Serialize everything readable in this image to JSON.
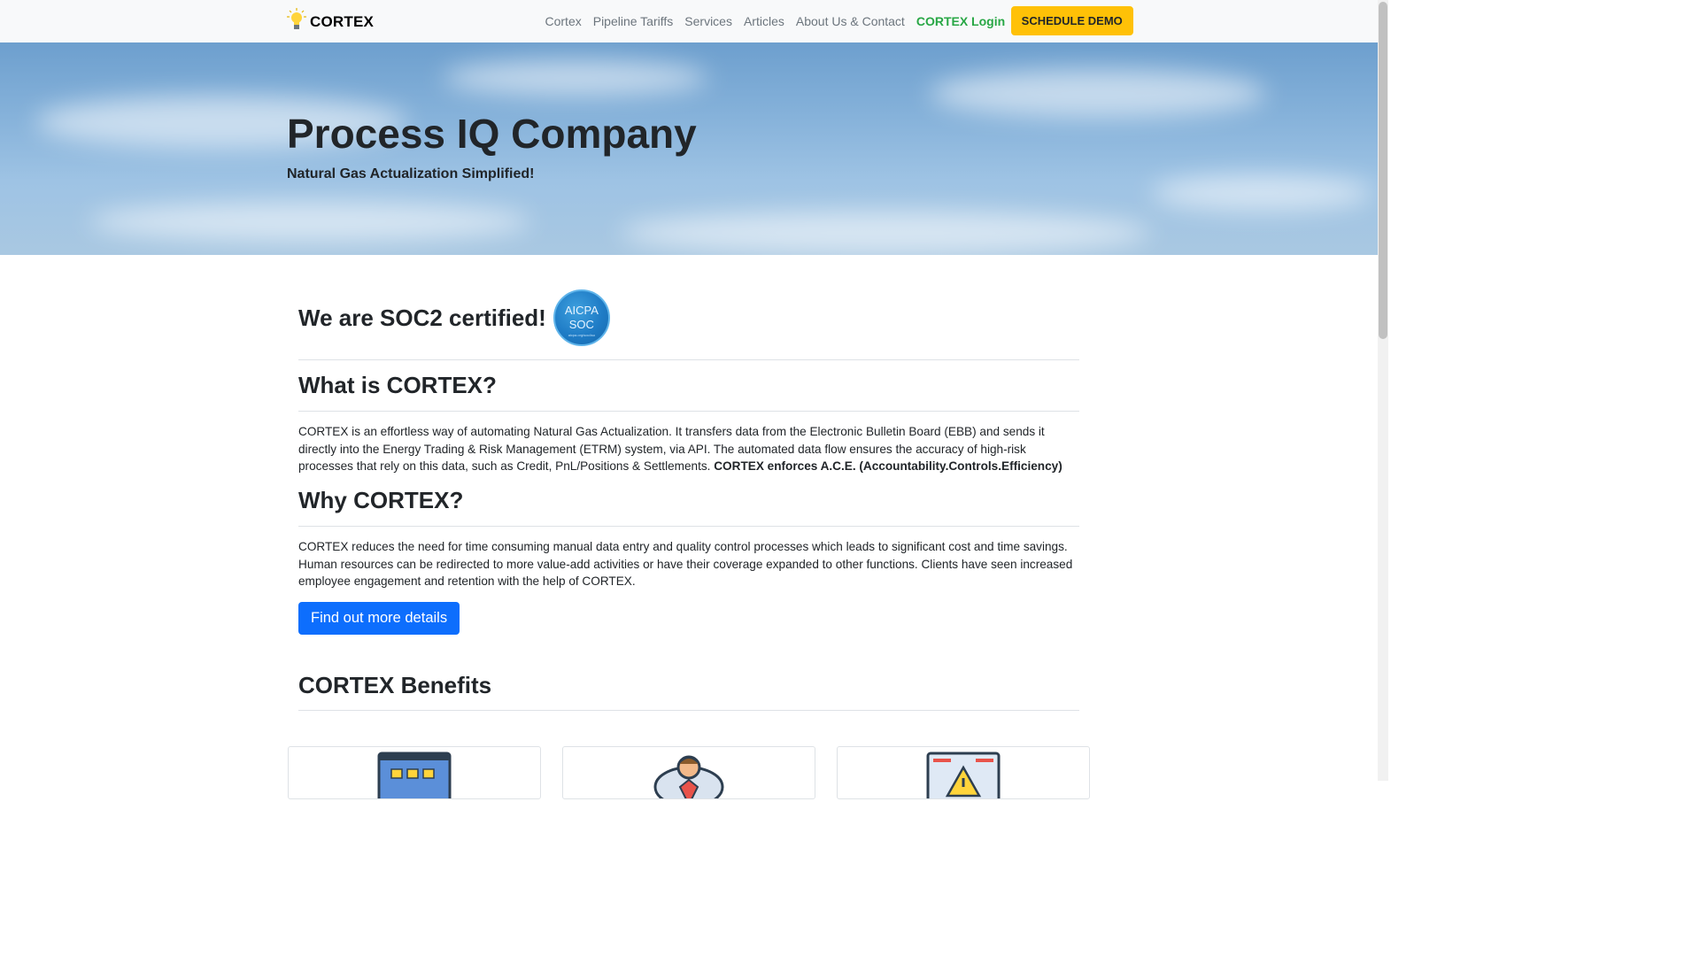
{
  "nav": {
    "brand": "CORTEX",
    "links": [
      "Cortex",
      "Pipeline Tariffs",
      "Services",
      "Articles",
      "About Us & Contact"
    ],
    "login": "CORTEX Login",
    "demo": "SCHEDULE DEMO"
  },
  "hero": {
    "title": "Process IQ Company",
    "subtitle": "Natural Gas Actualization Simplified!"
  },
  "soc": {
    "heading": "We are SOC2 certified!",
    "badge_line1": "AICPA",
    "badge_line2": "SOC",
    "badge_line3": "aicpa.org/soc4so"
  },
  "what": {
    "heading": "What is CORTEX?",
    "body": "CORTEX is an effortless way of automating Natural Gas Actualization. It transfers data from the Electronic Bulletin Board (EBB) and sends it directly into the Energy Trading & Risk Management (ETRM) system, via API. The automated data flow ensures the accuracy of high-risk processes that rely on this data, such as Credit, PnL/Positions & Settlements.",
    "body_bold": "CORTEX enforces A.C.E. (Accountability.Controls.Efficiency)"
  },
  "why": {
    "heading": "Why CORTEX?",
    "body": "CORTEX reduces the need for time consuming manual data entry and quality control processes which leads to significant cost and time savings. Human resources can be redirected to more value-add activities or have their coverage expanded to other functions. Clients have seen increased employee engagement and retention with the help of CORTEX."
  },
  "cta": {
    "label": "Find out more details"
  },
  "benefits": {
    "heading": "CORTEX Benefits"
  },
  "colors": {
    "accent_blue": "#0d6efd",
    "demo_yellow": "#ffc107",
    "login_green": "#28a745"
  },
  "icons": [
    "lightbulb-icon",
    "dashboard-icon",
    "user-icon",
    "warning-icon"
  ]
}
